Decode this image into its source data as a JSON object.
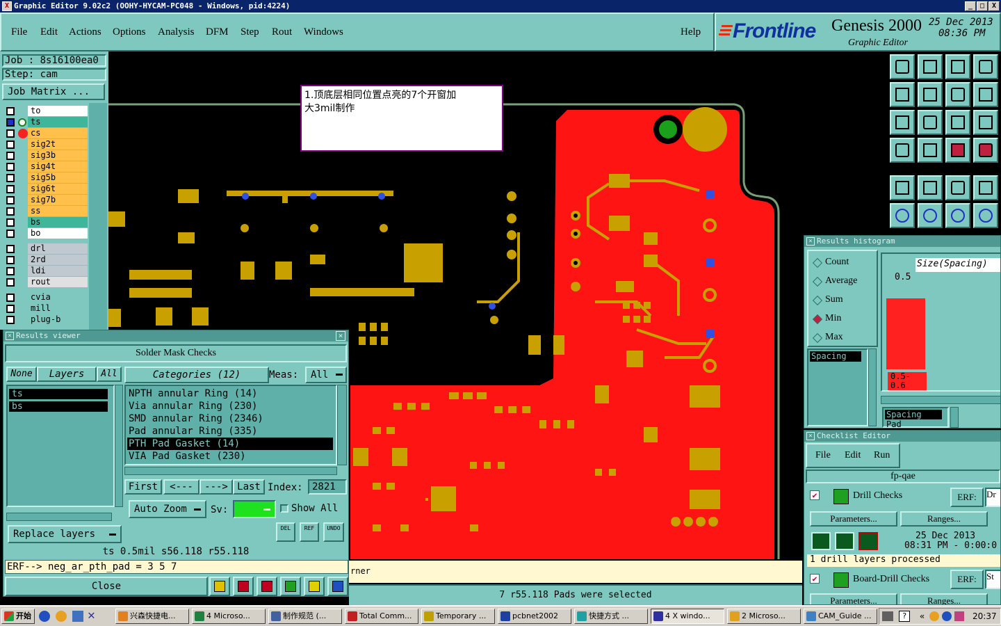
{
  "window": {
    "title": "Graphic Editor 9.02c2 (OOHY-HYCAM-PC048 - Windows, pid:4224)",
    "controls": [
      "_",
      "□",
      "X"
    ]
  },
  "menu": {
    "items": [
      "File",
      "Edit",
      "Actions",
      "Options",
      "Analysis",
      "DFM",
      "Step",
      "Rout",
      "Windows"
    ],
    "help": "Help"
  },
  "brand": {
    "logo": "Frontline",
    "product": "Genesis 2000",
    "subtitle": "Graphic Editor",
    "date": "25 Dec 2013",
    "time": "08:36 PM"
  },
  "job": {
    "job_label": "Job : 8s16100ea0",
    "step_label": "Step: cam",
    "matrix_button": "Job Matrix ..."
  },
  "layers": {
    "board": [
      {
        "name": "to",
        "color": "#ffffff"
      },
      {
        "name": "ts",
        "color": "#3fb59a"
      },
      {
        "name": "cs",
        "color": "#ffc04c"
      },
      {
        "name": "sig2t",
        "color": "#ffc04c"
      },
      {
        "name": "sig3b",
        "color": "#ffc04c"
      },
      {
        "name": "sig4t",
        "color": "#ffc04c"
      },
      {
        "name": "sig5b",
        "color": "#ffc04c"
      },
      {
        "name": "sig6t",
        "color": "#ffc04c"
      },
      {
        "name": "sig7b",
        "color": "#ffc04c"
      },
      {
        "name": "ss",
        "color": "#ffc04c"
      },
      {
        "name": "bs",
        "color": "#3fb59a"
      },
      {
        "name": "bo",
        "color": "#ffffff"
      }
    ],
    "drill": [
      {
        "name": "drl",
        "color": "#c0c8d0"
      },
      {
        "name": "2rd",
        "color": "#c0c8d0"
      },
      {
        "name": "ldi",
        "color": "#c0c8d0"
      },
      {
        "name": "rout",
        "color": "#e0e0e0"
      }
    ],
    "other": [
      {
        "name": "cvia",
        "color": "#7ec8c0"
      },
      {
        "name": "mill",
        "color": "#7ec8c0"
      },
      {
        "name": "plug-b",
        "color": "#7ec8c0"
      }
    ]
  },
  "annotation": {
    "line1": "1.顶底层相同位置点亮的7个开窗加",
    "line2": "大3mil制作"
  },
  "results_viewer": {
    "title": "Results viewer",
    "header": "Solder Mask Checks",
    "none_label": "None",
    "layers_label": "Layers",
    "all_label": "All",
    "layers": [
      "ts",
      "bs"
    ],
    "categories_label": "Categories (12)",
    "meas_label": "Meas:",
    "meas_value": "All",
    "categories": [
      "NPTH annular Ring (14)",
      "Via annular Ring (230)",
      "SMD annular Ring (2346)",
      "Pad annular Ring (335)",
      "PTH Pad Gasket (14)",
      "VIA Pad Gasket (230)"
    ],
    "selected_category": 4,
    "first_label": "First",
    "prev_label": "<---",
    "next_label": "--->",
    "last_label": "Last",
    "index_label": "Index:",
    "index_value": "2821",
    "replace_label": "Replace layers",
    "autozoom_label": "Auto Zoom",
    "sv_label": "Sv:",
    "show_all_label": "Show All",
    "del_label": "DEL",
    "ref_label": "REF",
    "undo_label": "UNDO",
    "status": "ts 0.5mil   s56.118  r55.118",
    "erf": "ERF--> neg_ar_pth_pad = 3 5 7",
    "close_label": "Close"
  },
  "status_bar": {
    "left": "rner",
    "message": "7 r55.118 Pads were selected"
  },
  "histogram": {
    "title": "Results histogram",
    "options": [
      "Count",
      "Average",
      "Sum",
      "Min",
      "Max"
    ],
    "selected_option": 3,
    "header": "Size(Spacing)",
    "bar_label": "0.5",
    "range_label1": "0.5-",
    "range_label2": "0.6",
    "list": [
      "Spacing"
    ],
    "list2": [
      "Spacing",
      "Pad"
    ],
    "bar_fraction": 0.82,
    "bar_color": "#ff2020"
  },
  "checklist": {
    "title": "Checklist Editor",
    "menu": [
      "File",
      "Edit",
      "Run"
    ],
    "name": "fp-qae",
    "checks": [
      {
        "name": "Drill Checks",
        "erf": "ERF:",
        "erf_value": "Dr",
        "params": "Parameters...",
        "ranges": "Ranges..."
      },
      {
        "name": "Board-Drill Checks",
        "erf": "ERF:",
        "erf_value": "St",
        "params": "Parameters...",
        "ranges": "Ranges..."
      }
    ],
    "run_date": "25 Dec 2013",
    "run_time": "08:31 PM - 0:00:0",
    "processed": "1 drill layers processed"
  },
  "taskbar": {
    "start": "开始",
    "tasks": [
      "兴森快捷电...",
      "4 Microso...",
      "制作规范 (...",
      "Total Comm...",
      "Temporary ...",
      "pcbnet2002",
      "快捷方式 ...",
      "4 X windo...",
      "2 Microso...",
      "CAM_Guide ..."
    ],
    "clock": "20:37"
  },
  "colors": {
    "panel": "#7ec8c0",
    "copper": "#c8a000",
    "mask": "#ff1010",
    "outline": "#6a9a6a"
  }
}
